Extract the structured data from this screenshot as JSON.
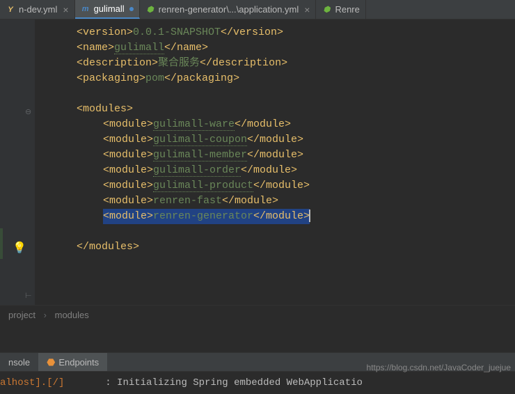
{
  "tabs": [
    {
      "label": "n-dev.yml",
      "icon": "yml"
    },
    {
      "label": "gulimall",
      "icon": "m",
      "active": true
    },
    {
      "label": "renren-generator\\...\\application.yml",
      "icon": "spring"
    },
    {
      "label": "Renre",
      "icon": "spring-run"
    }
  ],
  "code": {
    "version_open": "<version>",
    "version_val": "0.0.1-SNAPSHOT",
    "version_close": "</version>",
    "name_open": "<name>",
    "name_val": "gulimall",
    "name_close": "</name>",
    "desc_open": "<description>",
    "desc_val": "聚合服务",
    "desc_close": "</description>",
    "pack_open": "<packaging>",
    "pack_val": "pom",
    "pack_close": "</packaging>",
    "modules_open": "<modules>",
    "modules_close": "</modules>",
    "module_open": "<module>",
    "module_close": "</module>",
    "modules": [
      "gulimall-ware",
      "gulimall-coupon",
      "gulimall-member",
      "gulimall-order",
      "gulimall-product",
      "renren-fast",
      "renren-generator"
    ]
  },
  "breadcrumb": {
    "a": "project",
    "b": "modules"
  },
  "bottom_tabs": {
    "console": "nsole",
    "endpoints": "Endpoints"
  },
  "console": {
    "host": "alhost].[/]",
    "msg": ": Initializing Spring embedded WebApplicatio"
  },
  "watermark": "https://blog.csdn.net/JavaCoder_juejue"
}
